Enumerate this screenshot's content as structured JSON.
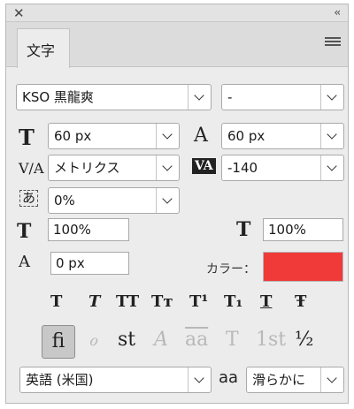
{
  "window": {
    "close_icon": "close-icon",
    "collapse_label": "‹‹"
  },
  "tab": {
    "label": "文字"
  },
  "font": {
    "family": "KSO 黒龍爽",
    "style": "-"
  },
  "size": {
    "font_size": "60 px",
    "leading": "60 px"
  },
  "kerning": {
    "value": "メトリクス",
    "tracking": "-140"
  },
  "tsume": {
    "value": "0%"
  },
  "scale": {
    "vertical": "100%",
    "horizontal": "100%"
  },
  "baseline": {
    "value": "0 px"
  },
  "color": {
    "label": "カラー：",
    "swatch": "#f03a3a"
  },
  "icon_glyphs": {
    "font_size": "T",
    "leading": "A",
    "kerning": "V/A",
    "tracking": "VA",
    "vertical_scale": "T",
    "horizontal_scale": "T",
    "baseline": "A",
    "tsume": "あ",
    "anti_alias": "a"
  },
  "type_styles": [
    "T",
    "T",
    "TT",
    "Tт",
    "T¹",
    "T₁",
    "T",
    "Ŧ"
  ],
  "opentype": [
    "fi",
    "ℴ",
    "st",
    "A",
    "aa",
    "T",
    "1st",
    "½"
  ],
  "bottom": {
    "language": "英語 (米国)",
    "anti_alias_label": "aa",
    "anti_alias": "滑らかに"
  }
}
